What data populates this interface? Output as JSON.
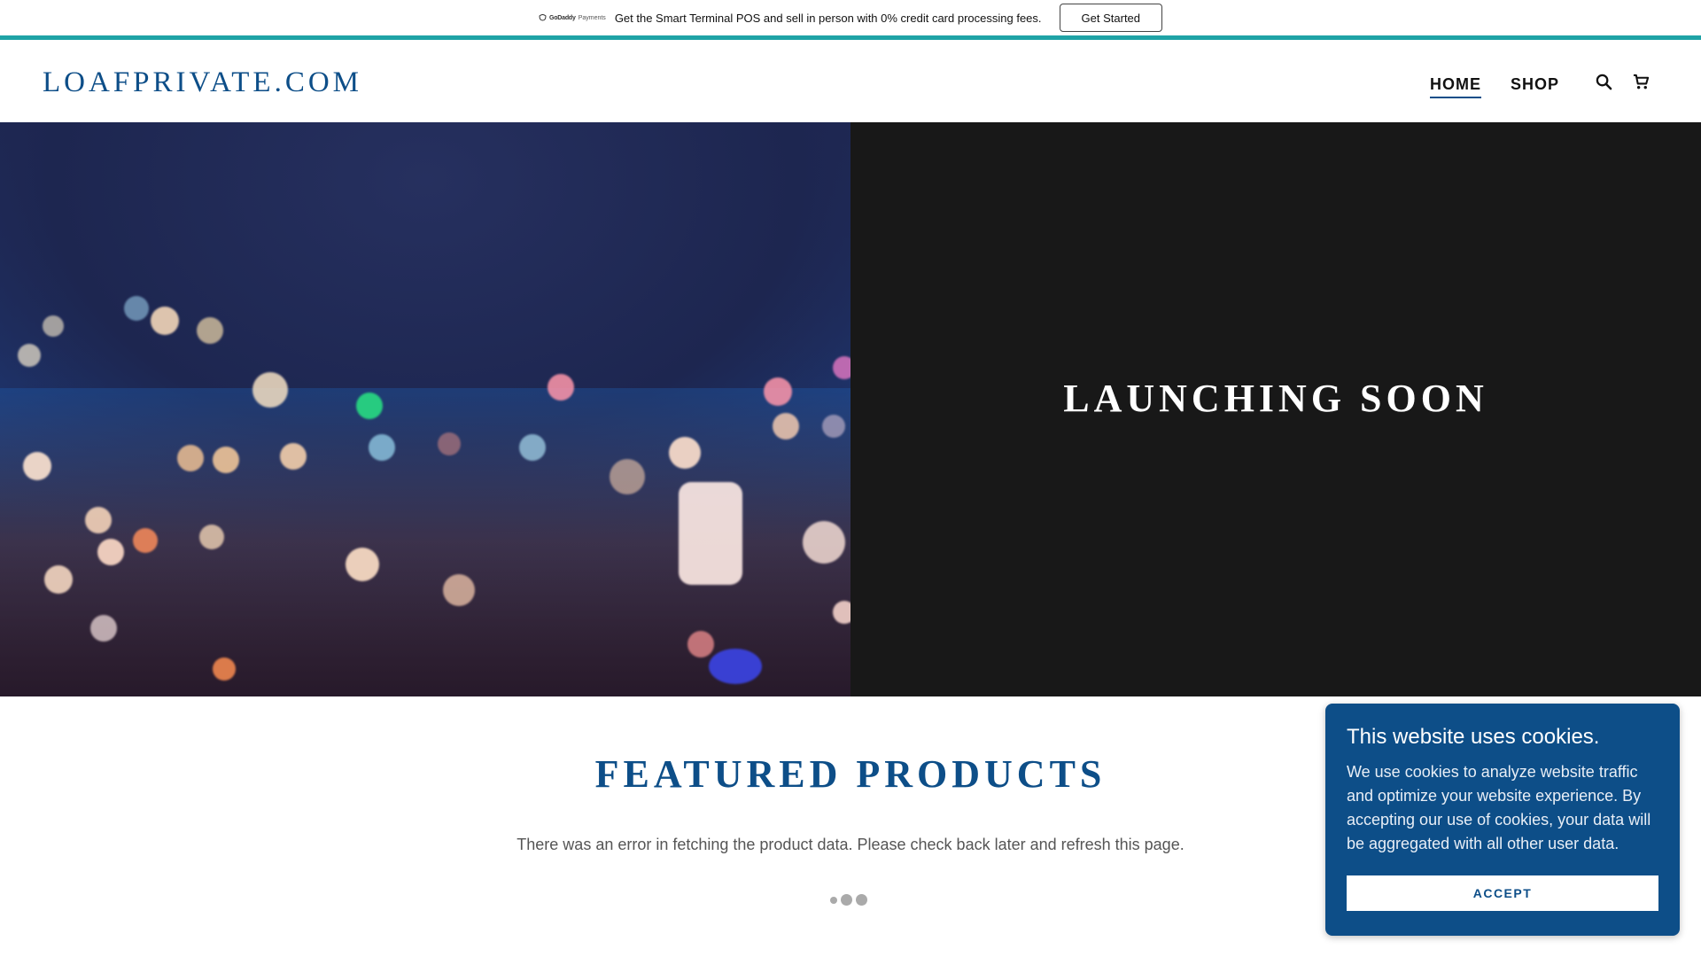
{
  "promo": {
    "logo_brand": "GoDaddy",
    "logo_product": "Payments",
    "text": "Get the Smart Terminal POS and sell in person with 0% credit card processing fees.",
    "button_label": "Get Started"
  },
  "header": {
    "brand": "LOAFPRIVATE.COM",
    "nav": [
      {
        "label": "HOME",
        "active": true
      },
      {
        "label": "SHOP",
        "active": false
      }
    ],
    "icons": [
      "search-icon",
      "cart-icon"
    ]
  },
  "hero": {
    "title": "LAUNCHING SOON"
  },
  "featured": {
    "title": "FEATURED PRODUCTS",
    "message": "There was an error in fetching the product data. Please check back later and refresh this page."
  },
  "cookie": {
    "title": "This website uses cookies.",
    "body": "We use cookies to analyze website traffic and optimize your website experience. By accepting our use of cookies, your data will be aggregated with all other user data.",
    "accept_label": "ACCEPT"
  },
  "colors": {
    "accent": "#0d4e88",
    "promo_border": "#1fa3a6",
    "hero_dark": "#181818"
  }
}
